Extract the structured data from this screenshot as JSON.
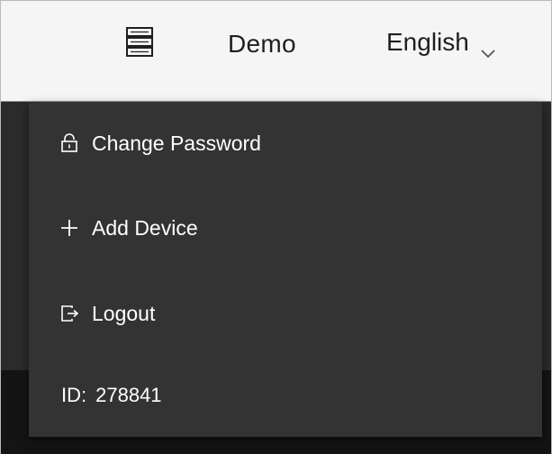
{
  "header": {
    "menu_icon": "server-list-icon",
    "user_name": "Demo",
    "language": "English",
    "language_chevron_icon": "chevron-down-icon"
  },
  "dropdown": {
    "items": [
      {
        "icon": "lock-icon",
        "label": "Change Password"
      },
      {
        "icon": "plus-icon",
        "label": "Add Device"
      },
      {
        "icon": "logout-icon",
        "label": "Logout"
      }
    ],
    "id_label": "ID:",
    "id_value": "278841"
  },
  "colors": {
    "header_bg": "#f5f5f5",
    "dropdown_bg": "#333333",
    "backdrop": "#2b2b2b",
    "text_light": "#ffffff",
    "text_dark": "#1f1f1f"
  }
}
